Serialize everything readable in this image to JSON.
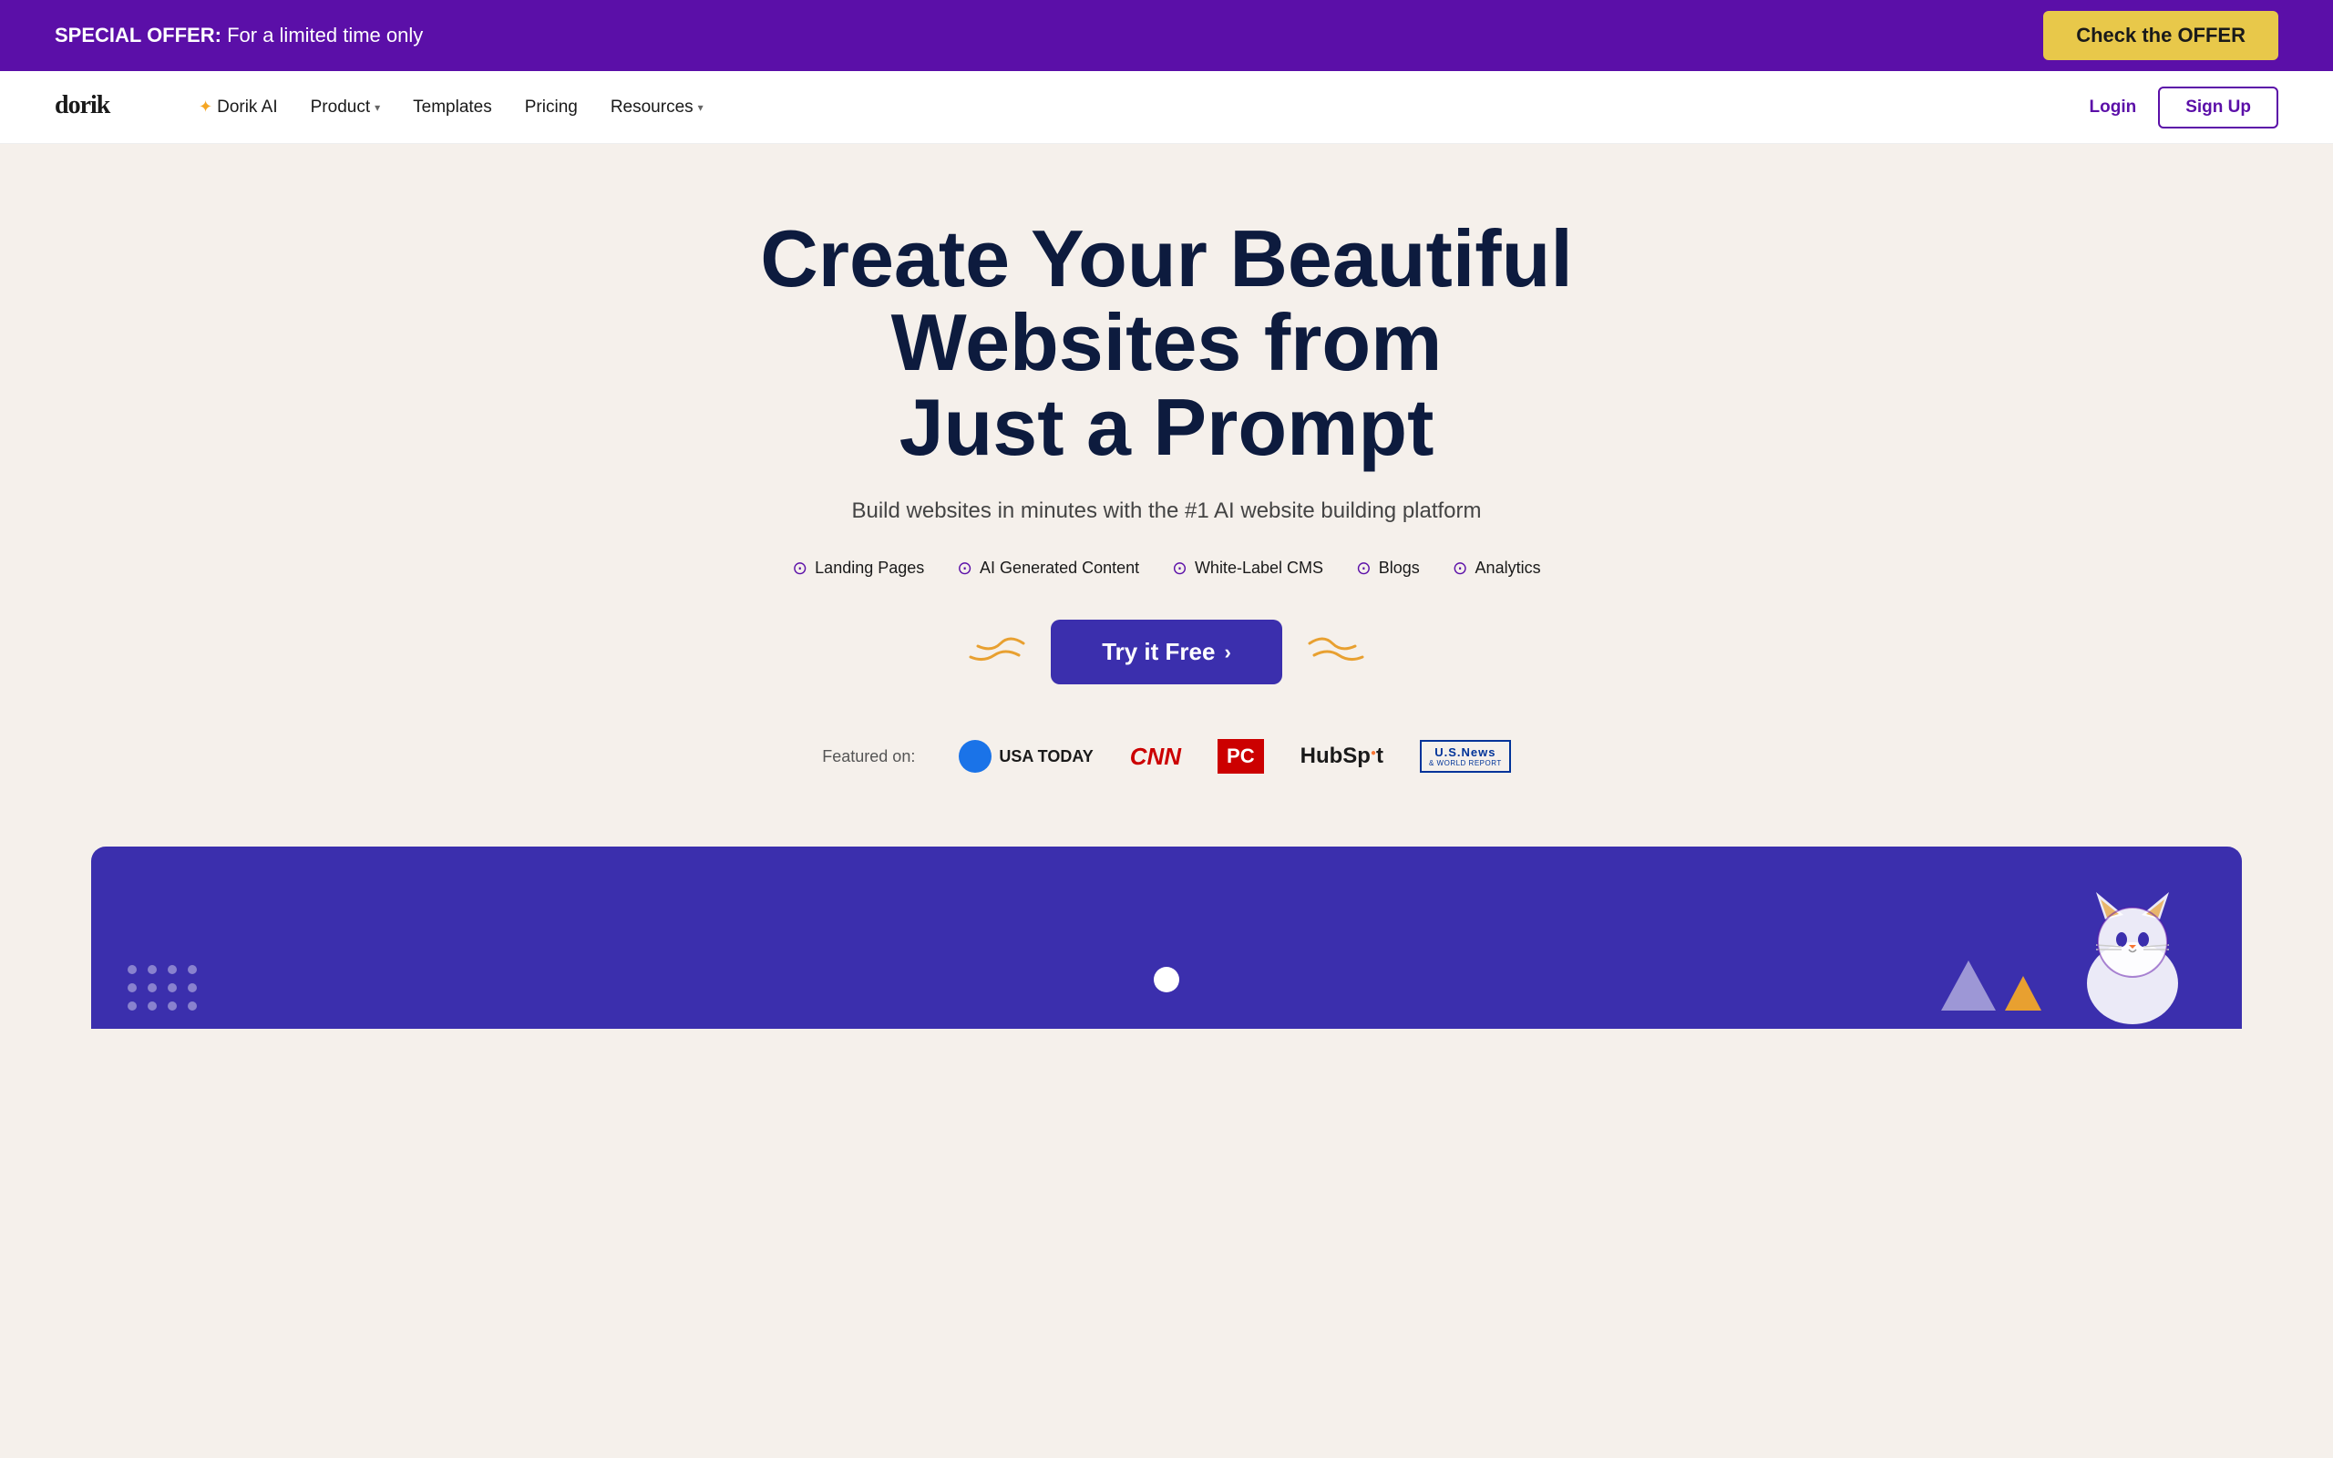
{
  "announcement": {
    "strong": "SPECIAL OFFER:",
    "text": " For a limited time only",
    "cta": "Check the OFFER"
  },
  "navbar": {
    "logo": "dorik",
    "links": [
      {
        "id": "dorik-ai",
        "label": "Dorik AI",
        "hasIcon": true,
        "hasChevron": false
      },
      {
        "id": "product",
        "label": "Product",
        "hasIcon": false,
        "hasChevron": true
      },
      {
        "id": "templates",
        "label": "Templates",
        "hasIcon": false,
        "hasChevron": false
      },
      {
        "id": "pricing",
        "label": "Pricing",
        "hasIcon": false,
        "hasChevron": false
      },
      {
        "id": "resources",
        "label": "Resources",
        "hasIcon": false,
        "hasChevron": true
      }
    ],
    "login": "Login",
    "signup": "Sign Up"
  },
  "hero": {
    "title_line1": "Create Your Beautiful Websites from",
    "title_line2": "Just a Prompt",
    "subtitle": "Build websites in minutes with the #1 AI website building platform",
    "features": [
      {
        "id": "landing-pages",
        "label": "Landing Pages"
      },
      {
        "id": "ai-content",
        "label": "AI Generated Content"
      },
      {
        "id": "white-label",
        "label": "White-Label CMS"
      },
      {
        "id": "blogs",
        "label": "Blogs"
      },
      {
        "id": "analytics",
        "label": "Analytics"
      }
    ],
    "cta": "Try it Free",
    "cta_arrow": "›"
  },
  "featured": {
    "label": "Featured on:",
    "logos": [
      {
        "id": "usa-today",
        "name": "USA TODAY"
      },
      {
        "id": "cnn",
        "name": "CNN"
      },
      {
        "id": "pc-mag",
        "name": "PC"
      },
      {
        "id": "hubspot",
        "name": "HubSpot"
      },
      {
        "id": "us-news",
        "name": "U.S.News"
      }
    ]
  },
  "colors": {
    "purple": "#5b0fa8",
    "dark_blue": "#3b2fad",
    "hero_dark": "#0d1b3e",
    "gold": "#e8c84a",
    "orange": "#e8a030",
    "red": "#cc0000",
    "bg": "#f5f0eb"
  }
}
